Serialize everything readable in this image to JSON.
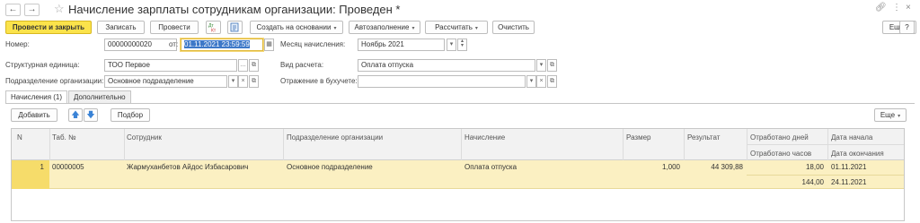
{
  "header": {
    "title": "Начисление зарплаты сотрудникам организации: Проведен *",
    "back_icon": "arrow-left",
    "forward_icon": "arrow-right",
    "star_icon": "star-outline",
    "link_icon": "link",
    "more_icon": "vertical-dots",
    "close_icon": "close"
  },
  "toolbar": {
    "post_and_close": "Провести и закрыть",
    "save": "Записать",
    "post": "Провести",
    "create_based_on": "Создать на основании",
    "autofill": "Автозаполнение",
    "calculate": "Рассчитать",
    "clear": "Очистить",
    "more": "Еще",
    "help": "?"
  },
  "form": {
    "number_label": "Номер:",
    "number_value": "00000000020",
    "from_label": "от:",
    "date_value": "01.11.2021 23:59:59",
    "month_label": "Месяц начисления:",
    "month_value": "Ноябрь 2021",
    "unit_label": "Структурная единица:",
    "unit_value": "ТОО Первое",
    "calc_type_label": "Вид расчета:",
    "calc_type_value": "Оплата отпуска",
    "division_label": "Подразделение организации:",
    "division_value": "Основное подразделение",
    "accounting_label": "Отражение в бухучете:",
    "accounting_value": ""
  },
  "tabs": [
    {
      "label": "Начисления (1)",
      "active": true
    },
    {
      "label": "Дополнительно",
      "active": false
    }
  ],
  "table_toolbar": {
    "add": "Добавить",
    "selection": "Подбор",
    "more": "Еще"
  },
  "table": {
    "columns": {
      "n": "N",
      "tab_no": "Таб. №",
      "employee": "Сотрудник",
      "division": "Подразделение организации",
      "accrual": "Начисление",
      "amount": "Размер",
      "result": "Результат",
      "worked_days": "Отработано дней",
      "worked_hours": "Отработано часов",
      "start_date": "Дата начала",
      "end_date": "Дата окончания"
    },
    "rows": [
      {
        "n": "1",
        "tab_no": "00000005",
        "employee": "Жармуханбетов Айдос Избасарович",
        "division": "Основное подразделение",
        "accrual": "Оплата отпуска",
        "amount": "1,000",
        "result": "44 309,88",
        "worked_days": "18,00",
        "worked_hours": "144,00",
        "start_date": "01.11.2021",
        "end_date": "24.11.2021"
      }
    ]
  },
  "colors": {
    "primary_button": "#fbe34b",
    "selected_row": "#fbf0c2",
    "arrow_blue": "#3a83d6"
  }
}
